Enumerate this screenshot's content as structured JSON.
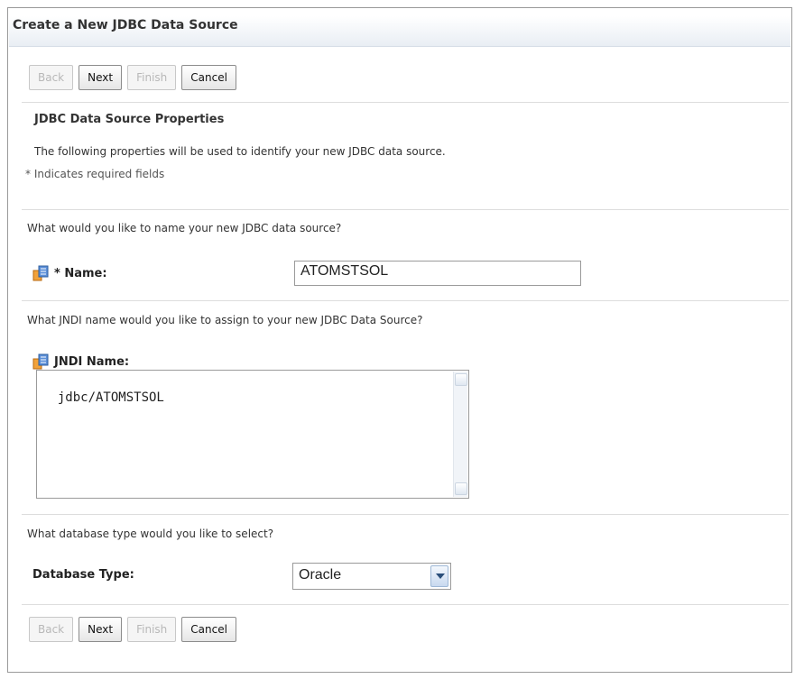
{
  "header": {
    "title": "Create a New JDBC Data Source"
  },
  "buttons": {
    "back": "Back",
    "next": "Next",
    "finish": "Finish",
    "cancel": "Cancel"
  },
  "section": {
    "title": "JDBC Data Source Properties",
    "description": "The following properties will be used to identify your new JDBC data source.",
    "required_note": "* Indicates required fields"
  },
  "name_field": {
    "question": "What would you like to name your new JDBC data source?",
    "label": "* Name:",
    "value": "ATOMSTSOL",
    "icon": "database-icon"
  },
  "jndi_field": {
    "question": "What JNDI name would you like to assign to your new JDBC Data Source?",
    "label": "JNDI Name:",
    "value": "jdbc/ATOMSTSOL",
    "icon": "database-icon"
  },
  "db_type": {
    "question": "What database type would you like to select?",
    "label": "Database Type:",
    "selected": "Oracle"
  },
  "colors": {
    "disabled_text": "#b8b8b8",
    "border": "#9a9a9a",
    "title_gradient_end": "#e9eef4"
  }
}
